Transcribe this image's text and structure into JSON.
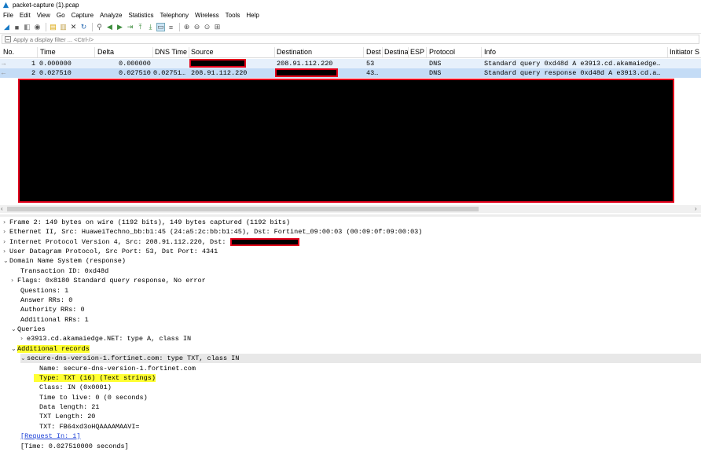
{
  "window": {
    "title": "packet-capture (1).pcap"
  },
  "menu": [
    "File",
    "Edit",
    "View",
    "Go",
    "Capture",
    "Analyze",
    "Statistics",
    "Telephony",
    "Wireless",
    "Tools",
    "Help"
  ],
  "filter": {
    "placeholder": "Apply a display filter ... <Ctrl-/>"
  },
  "columns": [
    "No.",
    "Time",
    "Delta",
    "DNS Time",
    "Source",
    "Destination",
    "Dest",
    "Destina",
    "ESP",
    "Protocol",
    "Info",
    "Initiator S"
  ],
  "packets": [
    {
      "no": "1",
      "time": "0.000000",
      "delta": "0.000000",
      "dns_time": "",
      "source": "",
      "destination": "208.91.112.220",
      "dest": "53",
      "protocol": "DNS",
      "info": "Standard query 0xd48d A e3913.cd.akamaiedge…"
    },
    {
      "no": "2",
      "time": "0.027510",
      "delta": "0.027510",
      "dns_time": "0.02751…",
      "source": "208.91.112.220",
      "destination": "",
      "dest": "43…",
      "protocol": "DNS",
      "info": "Standard query response 0xd48d A e3913.cd.a…"
    }
  ],
  "details": {
    "frame": "Frame 2: 149 bytes on wire (1192 bits), 149 bytes captured (1192 bits)",
    "ethernet": "Ethernet II, Src: HuaweiTechno_bb:b1:45 (24:a5:2c:bb:b1:45), Dst: Fortinet_09:00:03 (00:09:0f:09:00:03)",
    "ip": "Internet Protocol Version 4, Src: 208.91.112.220, Dst:",
    "udp": "User Datagram Protocol, Src Port: 53, Dst Port: 4341",
    "dns": "Domain Name System (response)",
    "transaction_id": "Transaction ID: 0xd48d",
    "flags": "Flags: 0x8180 Standard query response, No error",
    "questions": "Questions: 1",
    "answer_rrs": "Answer RRs: 0",
    "authority_rrs": "Authority RRs: 0",
    "additional_rrs": "Additional RRs: 1",
    "queries": "Queries",
    "query_item": "e3913.cd.akamaiedge.NET: type A, class IN",
    "additional_records": "Additional records",
    "record": "secure-dns-version-1.fortinet.com: type TXT, class IN",
    "name": "Name: secure-dns-version-1.fortinet.com",
    "type": "Type: TXT (16) (Text strings)",
    "class": "Class: IN (0x0001)",
    "ttl": "Time to live: 0 (0 seconds)",
    "data_length": "Data length: 21",
    "txt_length": "TXT Length: 20",
    "txt": "TXT: FB64xd3oHQAAAAMAAVI=",
    "request_in": "[Request In: 1]",
    "time": "[Time: 0.027510000 seconds]"
  }
}
